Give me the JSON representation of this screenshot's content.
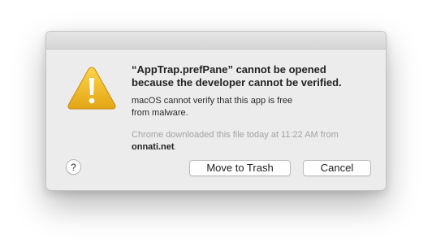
{
  "dialog": {
    "headline_line1": "“AppTrap.prefPane” cannot be opened",
    "headline_line2": "because the developer cannot be verified.",
    "message_line1": "macOS cannot verify that this app is free",
    "message_line2": "from malware.",
    "source_line1": "Chrome downloaded this file today at 11:22 AM from",
    "source_domain": "onnati.net",
    "source_suffix": ".",
    "icon": "warning-triangle-icon",
    "accent_color": "#f0b21d"
  },
  "buttons": {
    "help_label": "?",
    "move_to_trash_label": "Move to Trash",
    "cancel_label": "Cancel"
  }
}
